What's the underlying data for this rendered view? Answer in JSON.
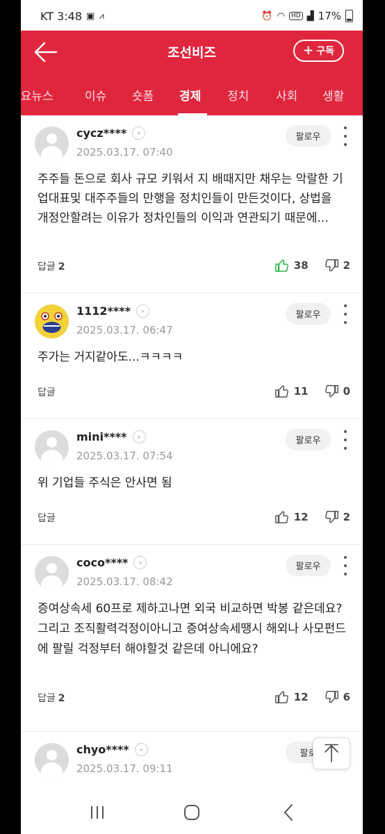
{
  "status_bar": {
    "carrier_time": "KT 3:48",
    "battery": "17%"
  },
  "header": {
    "title": "조선비즈",
    "subscribe_label": "구독"
  },
  "tabs": [
    {
      "label": "주요뉴스"
    },
    {
      "label": "이슈"
    },
    {
      "label": "숏폼"
    },
    {
      "label": "경제",
      "active": true
    },
    {
      "label": "정치"
    },
    {
      "label": "사회"
    },
    {
      "label": "생활"
    }
  ],
  "colors": {
    "brand_red": "#e0263d",
    "like_green": "#2bb34a"
  },
  "comments": [
    {
      "user": "cycz****",
      "date": "2025.03.17. 07:40",
      "follow": "팔로우",
      "text": "주주들 돈으로 회사 규모 키워서 지 배때지만 채우는 악랄한 기업대표및 대주주들의 만행을 정치인들이 만든것이다, 상법을 개정안할려는 이유가 정차인들의 이익과 연관되기 때문에...",
      "reply_label": "답글",
      "reply_count": "2",
      "likes": "38",
      "dislikes": "2",
      "liked": true,
      "avatar": "default"
    },
    {
      "user": "1112****",
      "date": "2025.03.17. 06:47",
      "follow": "팔로우",
      "text": "주가는 거지같아도...ㅋㅋㅋㅋ",
      "reply_label": "답글",
      "reply_count": "",
      "likes": "11",
      "dislikes": "0",
      "liked": false,
      "avatar": "emoji"
    },
    {
      "user": "mini****",
      "date": "2025.03.17. 07:54",
      "follow": "팔로우",
      "text": "위 기업들 주식은 안사면 됨",
      "reply_label": "답글",
      "reply_count": "",
      "likes": "12",
      "dislikes": "2",
      "liked": false,
      "avatar": "default"
    },
    {
      "user": "coco****",
      "date": "2025.03.17. 08:42",
      "follow": "팔로우",
      "text": "증여상속세 60프로 제하고나면 외국 비교하면 박봉 같은데요? 그리고 조직활력걱정이아니고 증여상속세땡시 해외나 사모펀드에 팔릴 걱정부터 해야할것 같은데 아니에요?",
      "reply_label": "답글",
      "reply_count": "2",
      "likes": "12",
      "dislikes": "6",
      "liked": false,
      "avatar": "default"
    },
    {
      "user": "chyo****",
      "date": "2025.03.17. 09:11",
      "follow": "팔로",
      "text": "",
      "reply_label": "",
      "reply_count": "",
      "likes": "",
      "dislikes": "",
      "liked": false,
      "avatar": "default"
    }
  ],
  "icons": {
    "back": "arrow-left-icon",
    "plus": "plus-icon",
    "chevron": "chevron-right-icon",
    "more": "more-vertical-icon",
    "like": "thumbs-up-icon",
    "dislike": "thumbs-down-icon",
    "scroll_top": "arrow-up-icon",
    "nav_recents": "recents-icon",
    "nav_home": "home-icon",
    "nav_back": "nav-back-icon"
  }
}
